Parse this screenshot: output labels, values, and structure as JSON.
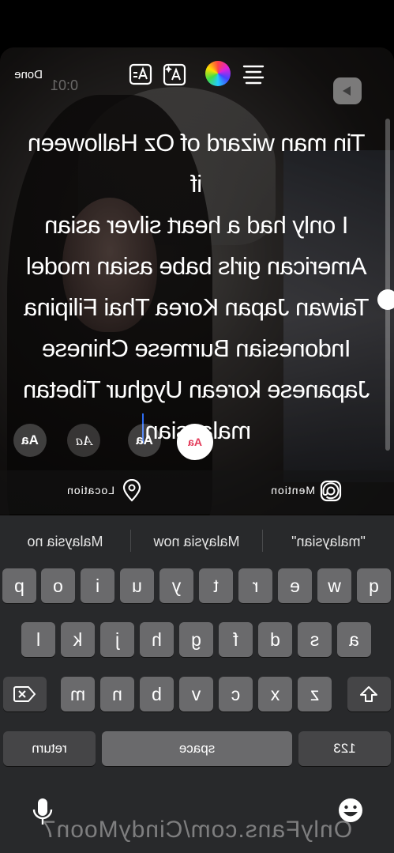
{
  "toolbar": {
    "done_label": "Done",
    "timer": "0:01",
    "icons": [
      "text-align-icon",
      "text-animation-icon",
      "text-effect-icon",
      "color-wheel-icon",
      "clip-icon"
    ]
  },
  "caption": {
    "lines": [
      "Tin man wizard of Oz Halloween if",
      "I only had a heart silver asian",
      "American girls babe asian model",
      "Taiwan Japan Korea Thai Filipina",
      "Indonesian Burmese Chinese",
      "Japanese korean Uyghur Tibetan",
      "malaysian"
    ]
  },
  "font_styles": {
    "label": "Aa",
    "selected_color": "#e33b5a"
  },
  "stickers": {
    "mention_label": "Mention",
    "location_label": "Location"
  },
  "keyboard": {
    "suggestions": [
      "\"malaysian\"",
      "Malaysia now",
      "Malaysia no"
    ],
    "row1": [
      "q",
      "w",
      "e",
      "r",
      "t",
      "y",
      "u",
      "i",
      "o",
      "p"
    ],
    "row2": [
      "a",
      "s",
      "d",
      "f",
      "g",
      "h",
      "j",
      "k",
      "l"
    ],
    "row3": [
      "z",
      "x",
      "c",
      "v",
      "b",
      "n",
      "m"
    ],
    "numbers_label": "123",
    "space_label": "space",
    "return_label": "return"
  },
  "watermark": "OnlyFans.com/CindyMoon7"
}
